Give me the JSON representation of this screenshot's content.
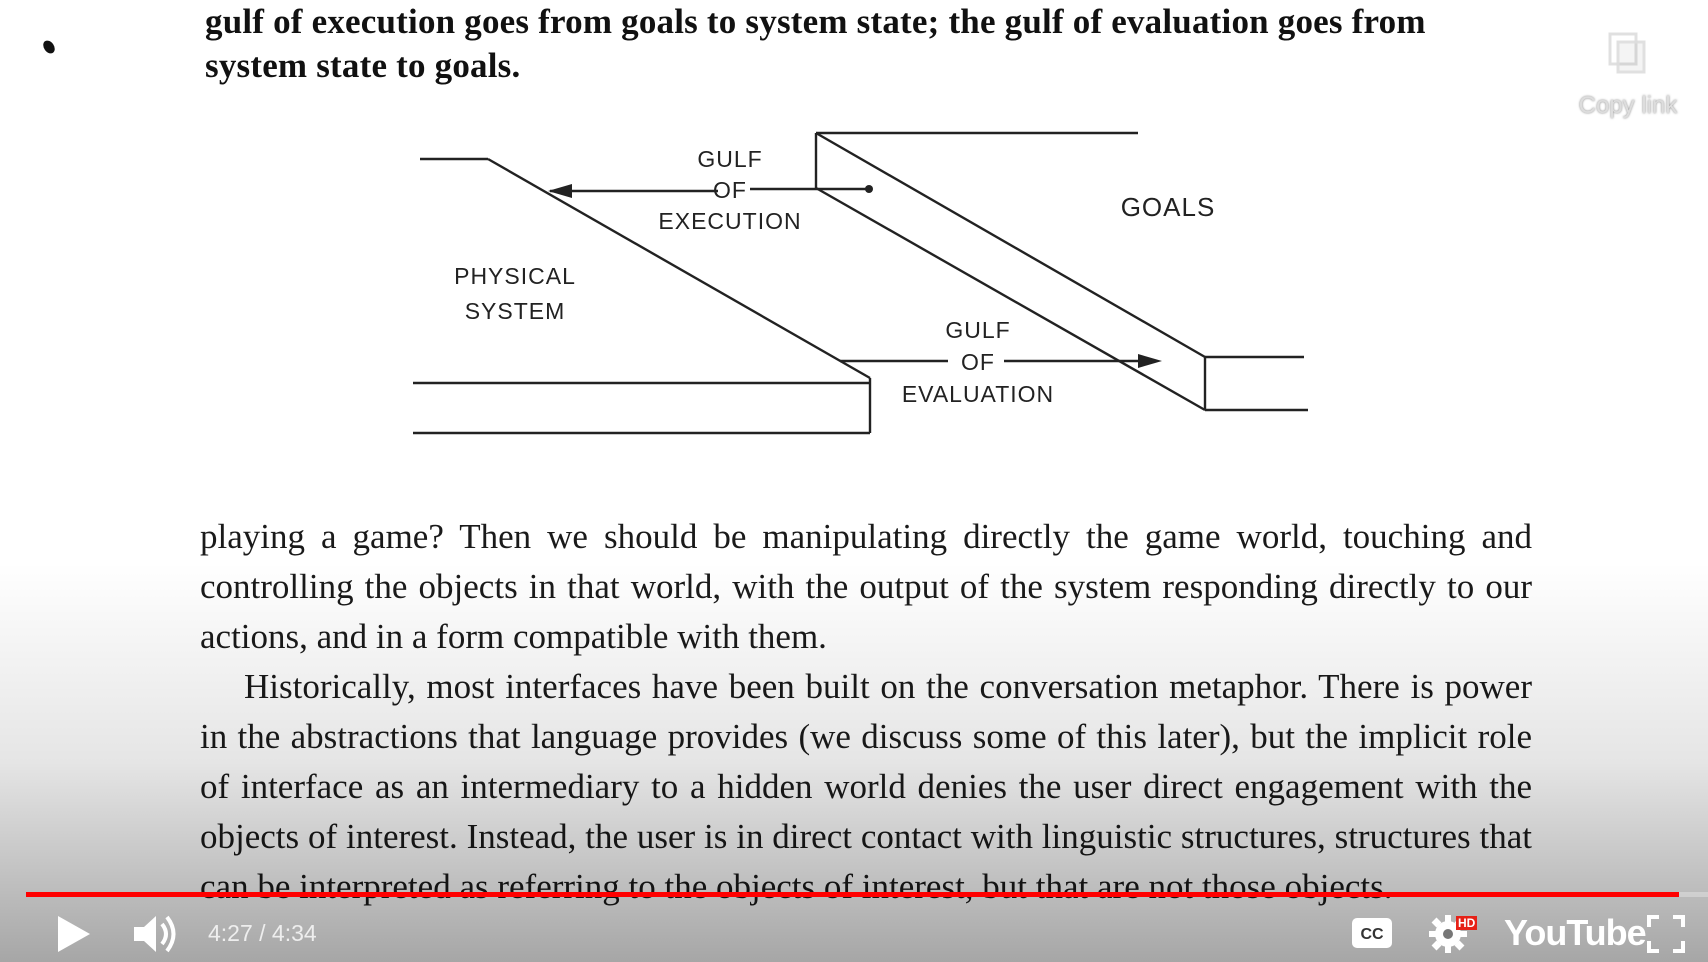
{
  "document": {
    "heading": "gulf of execution goes from goals to system state; the gulf of evaluation goes from system state to goals.",
    "diagram": {
      "label_gulf_exec_1": "GULF",
      "label_gulf_exec_2": "OF",
      "label_gulf_exec_3": "EXECUTION",
      "label_physical_1": "PHYSICAL",
      "label_physical_2": "SYSTEM",
      "label_goals": "GOALS",
      "label_gulf_eval_1": "GULF",
      "label_gulf_eval_2": "OF",
      "label_gulf_eval_3": "EVALUATION"
    },
    "paragraph_1": "playing a game? Then we should be manipulating directly the game world, touching and controlling the objects in that world, with the output of the system responding directly to our actions, and in a form compatible with them.",
    "paragraph_2": "Historically, most interfaces have been built on the conversation metaphor. There is power in the abstractions that language provides (we discuss some of this later), but the implicit role of interface as an intermediary to a hidden world denies the user direct engagement with the objects of interest. Instead, the user is in direct contact with linguistic structures, structures that can be interpreted as referring to the objects of interest, but that are not those objects."
  },
  "overlay": {
    "copy_link_label": "Copy link"
  },
  "player": {
    "progress": 0.983,
    "time_display": "4:27 / 4:34",
    "hd_badge": "HD",
    "logo_text": "YouTube",
    "accent_color": "#ff0000"
  }
}
